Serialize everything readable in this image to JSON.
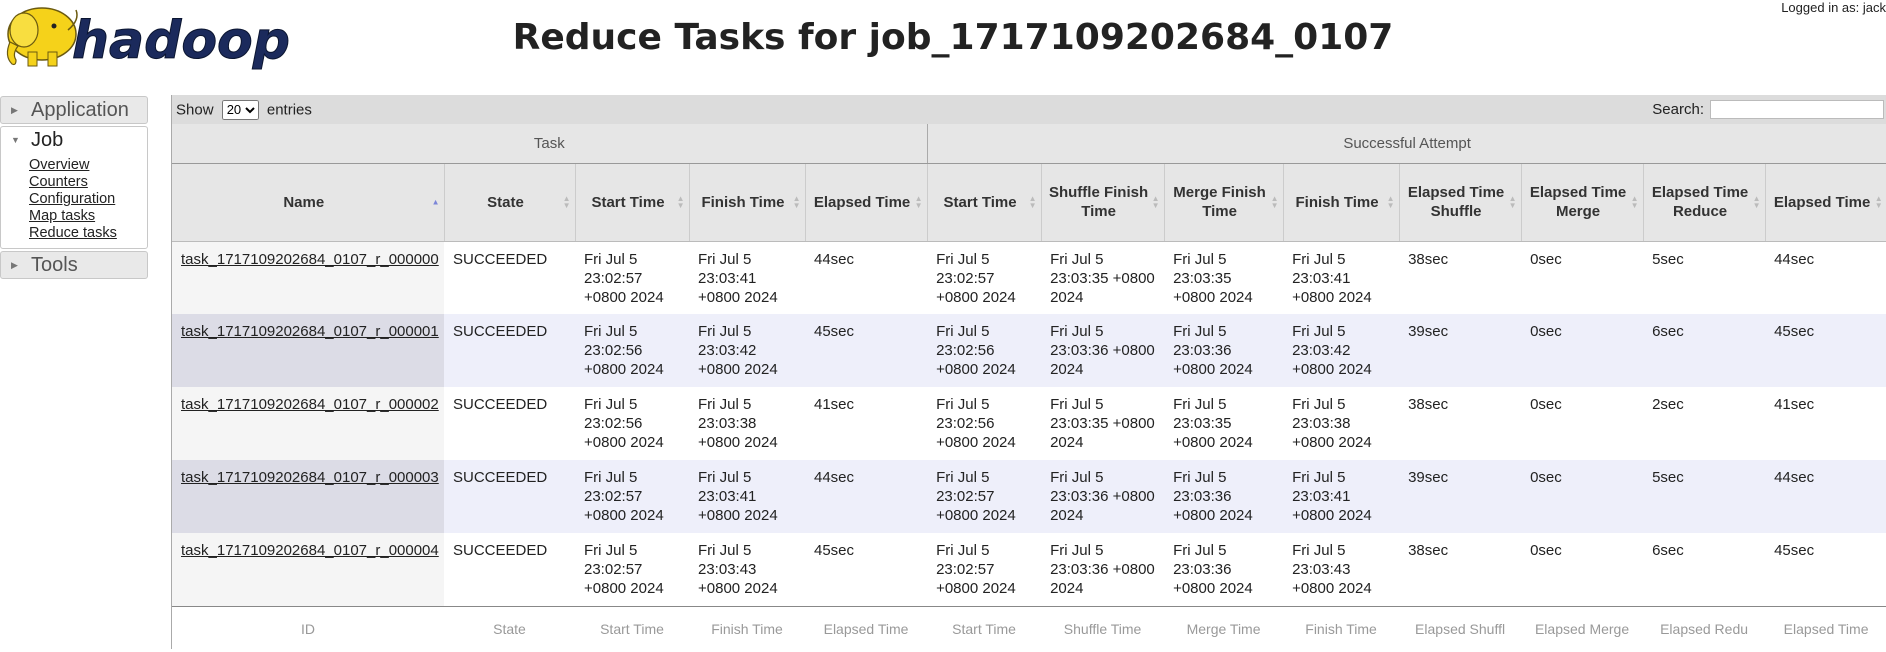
{
  "header": {
    "logo_text": "hadoop",
    "title": "Reduce Tasks for job_1717109202684_0107",
    "user": "Logged in as: jack"
  },
  "nav": {
    "application": "Application",
    "job": "Job",
    "job_links": [
      "Overview",
      "Counters",
      "Configuration",
      "Map tasks",
      "Reduce tasks"
    ],
    "tools": "Tools"
  },
  "toolbar": {
    "show_label": "Show",
    "page_size": "20",
    "entries_label": "entries",
    "search_label": "Search:",
    "search_value": ""
  },
  "table": {
    "groups": [
      "Task",
      "Successful Attempt"
    ],
    "columns": [
      "Name",
      "State",
      "Start Time",
      "Finish Time",
      "Elapsed Time",
      "Start Time",
      "Shuffle Finish Time",
      "Merge Finish Time",
      "Finish Time",
      "Elapsed Time Shuffle",
      "Elapsed Time Merge",
      "Elapsed Time Reduce",
      "Elapsed Time"
    ],
    "sort_column": "Name",
    "rows": [
      [
        "task_1717109202684_0107_r_000000",
        "SUCCEEDED",
        "Fri Jul 5 23:02:57 +0800 2024",
        "Fri Jul 5 23:03:41 +0800 2024",
        "44sec",
        "Fri Jul 5 23:02:57 +0800 2024",
        "Fri Jul 5 23:03:35 +0800 2024",
        "Fri Jul 5 23:03:35 +0800 2024",
        "Fri Jul 5 23:03:41 +0800 2024",
        "38sec",
        "0sec",
        "5sec",
        "44sec"
      ],
      [
        "task_1717109202684_0107_r_000001",
        "SUCCEEDED",
        "Fri Jul 5 23:02:56 +0800 2024",
        "Fri Jul 5 23:03:42 +0800 2024",
        "45sec",
        "Fri Jul 5 23:02:56 +0800 2024",
        "Fri Jul 5 23:03:36 +0800 2024",
        "Fri Jul 5 23:03:36 +0800 2024",
        "Fri Jul 5 23:03:42 +0800 2024",
        "39sec",
        "0sec",
        "6sec",
        "45sec"
      ],
      [
        "task_1717109202684_0107_r_000002",
        "SUCCEEDED",
        "Fri Jul 5 23:02:56 +0800 2024",
        "Fri Jul 5 23:03:38 +0800 2024",
        "41sec",
        "Fri Jul 5 23:02:56 +0800 2024",
        "Fri Jul 5 23:03:35 +0800 2024",
        "Fri Jul 5 23:03:35 +0800 2024",
        "Fri Jul 5 23:03:38 +0800 2024",
        "38sec",
        "0sec",
        "2sec",
        "41sec"
      ],
      [
        "task_1717109202684_0107_r_000003",
        "SUCCEEDED",
        "Fri Jul 5 23:02:57 +0800 2024",
        "Fri Jul 5 23:03:41 +0800 2024",
        "44sec",
        "Fri Jul 5 23:02:57 +0800 2024",
        "Fri Jul 5 23:03:36 +0800 2024",
        "Fri Jul 5 23:03:36 +0800 2024",
        "Fri Jul 5 23:03:41 +0800 2024",
        "39sec",
        "0sec",
        "5sec",
        "44sec"
      ],
      [
        "task_1717109202684_0107_r_000004",
        "SUCCEEDED",
        "Fri Jul 5 23:02:57 +0800 2024",
        "Fri Jul 5 23:03:43 +0800 2024",
        "45sec",
        "Fri Jul 5 23:02:57 +0800 2024",
        "Fri Jul 5 23:03:36 +0800 2024",
        "Fri Jul 5 23:03:36 +0800 2024",
        "Fri Jul 5 23:03:43 +0800 2024",
        "38sec",
        "0sec",
        "6sec",
        "45sec"
      ]
    ],
    "footer": [
      "ID",
      "State",
      "Start Time",
      "Finish Time",
      "Elapsed Time",
      "Start Time",
      "Shuffle Time",
      "Merge Time",
      "Finish Time",
      "Elapsed Shuffl",
      "Elapsed Merge",
      "Elapsed Redu",
      "Elapsed Time"
    ]
  },
  "colors": {
    "logo_yellow": "#f5d21a",
    "logo_navy": "#1b2a5c",
    "row_stripe": "#eeeffa",
    "header_gray": "#e6e6e6",
    "sort_asc": "#7b85d8"
  }
}
